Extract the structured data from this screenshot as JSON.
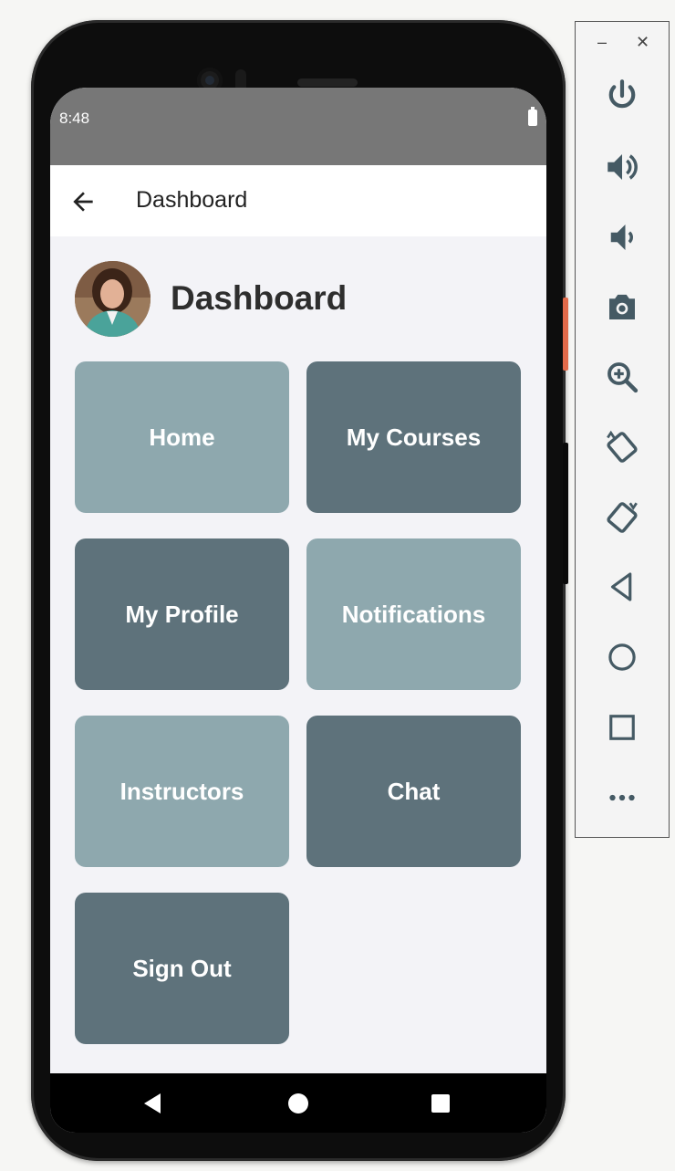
{
  "status_bar": {
    "time": "8:48"
  },
  "app_bar": {
    "title": "Dashboard"
  },
  "header": {
    "title": "Dashboard"
  },
  "tiles": [
    {
      "label": "Home",
      "color": "#8ea8ae"
    },
    {
      "label": "My Courses",
      "color": "#5e727b"
    },
    {
      "label": "My Profile",
      "color": "#5e727b"
    },
    {
      "label": "Notifications",
      "color": "#8ea8ae"
    },
    {
      "label": "Instructors",
      "color": "#8ea8ae"
    },
    {
      "label": "Chat",
      "color": "#5e727b"
    },
    {
      "label": "Sign Out",
      "color": "#5e727b"
    }
  ],
  "emulator_toolbar": {
    "minimize": "–",
    "close": "✕",
    "buttons": [
      "power-icon",
      "volume-up-icon",
      "volume-down-icon",
      "camera-icon",
      "zoom-icon",
      "rotate-left-icon",
      "rotate-right-icon",
      "back-icon",
      "home-icon",
      "overview-icon",
      "more-icon"
    ]
  }
}
